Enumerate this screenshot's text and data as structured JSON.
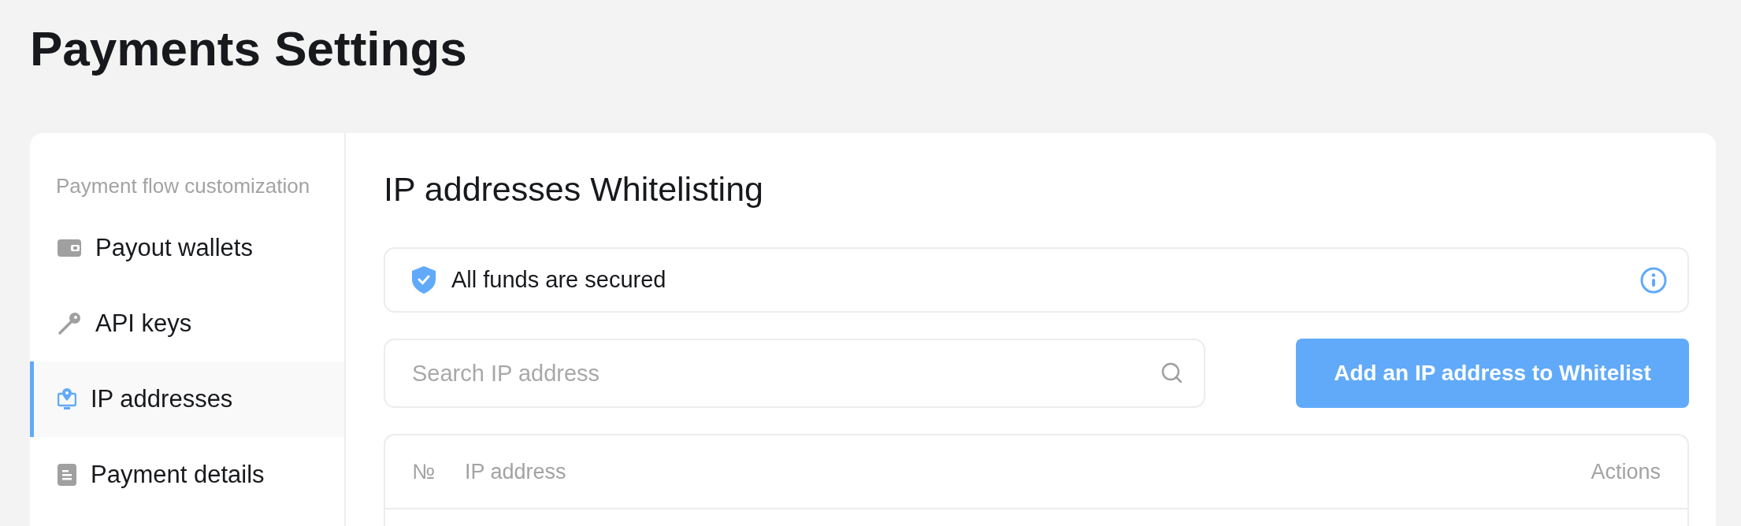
{
  "page": {
    "title": "Payments Settings"
  },
  "sidebar": {
    "heading": "Payment flow customization",
    "items": [
      {
        "label": "Payout wallets",
        "kind": "wallet",
        "selected": false
      },
      {
        "label": "API keys",
        "kind": "key",
        "selected": false
      },
      {
        "label": "IP addresses",
        "kind": "location",
        "selected": true
      },
      {
        "label": "Payment details",
        "kind": "document",
        "selected": false
      }
    ]
  },
  "content": {
    "heading": "IP addresses Whitelisting",
    "notice": "All funds are secured",
    "search": {
      "placeholder": "Search IP address"
    },
    "add_button": "Add an IP address to Whitelist",
    "table": {
      "columns": [
        "№",
        "IP address",
        "Actions"
      ]
    }
  }
}
